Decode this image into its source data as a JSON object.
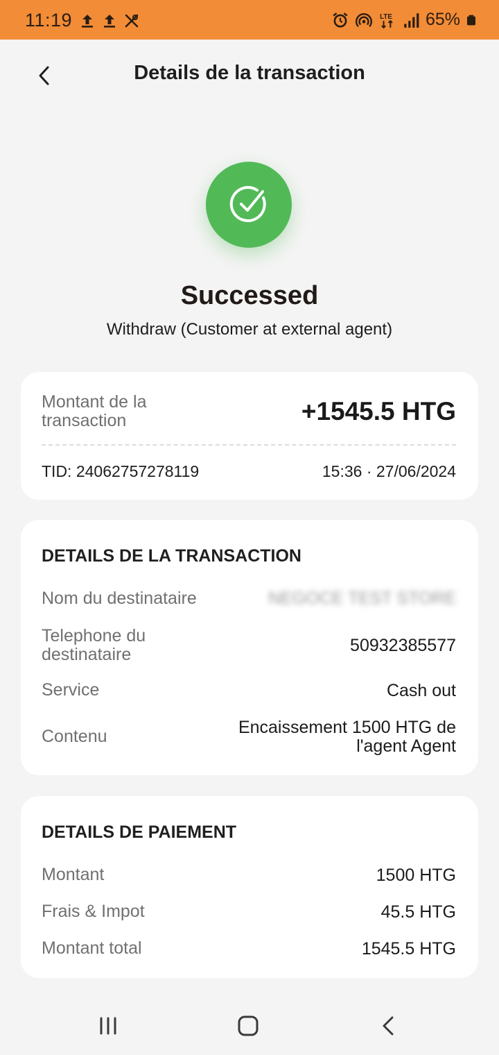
{
  "status_bar": {
    "time": "11:19",
    "battery": "65%",
    "network": "LTE",
    "color": "#f28c36",
    "left_icons": [
      "upload-icon",
      "upload-icon",
      "tools-off-icon"
    ],
    "right_icons": [
      "alarm-icon",
      "hotspot-icon",
      "lte-icon",
      "signal-icon",
      "battery-icon"
    ]
  },
  "header": {
    "title": "Details de la transaction",
    "back_icon": "chevron-left-icon"
  },
  "result": {
    "icon": "check-circle-icon",
    "status": "Successed",
    "subtitle": "Withdraw (Customer at external agent)",
    "accent": "#52b957"
  },
  "summary": {
    "amount_label": "Montant de la transaction",
    "amount_value": "+1545.5 HTG",
    "tid": "TID: 24062757278119",
    "datetime": "15:36 · 27/06/2024"
  },
  "transaction_details": {
    "title": "DETAILS DE LA TRANSACTION",
    "rows": [
      {
        "label": "Nom du destinataire",
        "value": "NEGOCE TEST STORE"
      },
      {
        "label": "Telephone du destinataire",
        "value": "50932385577"
      },
      {
        "label": "Service",
        "value": "Cash out"
      },
      {
        "label": "Contenu",
        "value": "Encaissement 1500 HTG de l'agent Agent"
      }
    ]
  },
  "payment_details": {
    "title": "DETAILS DE PAIEMENT",
    "rows": [
      {
        "label": "Montant",
        "value": "1500 HTG"
      },
      {
        "label": "Frais & Impot",
        "value": "45.5 HTG"
      },
      {
        "label": "Montant total",
        "value": "1545.5 HTG"
      }
    ]
  },
  "nav": {
    "items": [
      "recent-apps-icon",
      "home-icon",
      "back-icon"
    ]
  }
}
